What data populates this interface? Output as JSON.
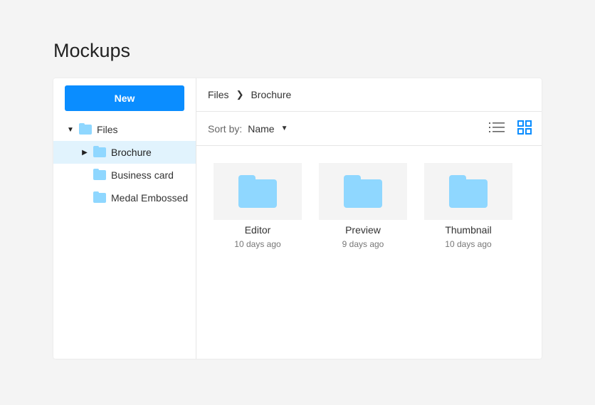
{
  "title": "Mockups",
  "sidebar": {
    "new_label": "New",
    "tree": [
      {
        "label": "Files",
        "expanded": true
      },
      {
        "label": "Brochure",
        "selected": true
      },
      {
        "label": "Business card"
      },
      {
        "label": "Medal Embossed"
      }
    ]
  },
  "breadcrumb": [
    "Files",
    "Brochure"
  ],
  "toolbar": {
    "sort_label": "Sort by:",
    "sort_value": "Name",
    "active_view": "grid"
  },
  "files": [
    {
      "name": "Editor",
      "modified": "10 days ago"
    },
    {
      "name": "Preview",
      "modified": "9 days ago"
    },
    {
      "name": "Thumbnail",
      "modified": "10 days ago"
    }
  ],
  "colors": {
    "accent": "#0a8dff",
    "folder": "#8fd7ff",
    "selected": "#e1f3fd"
  }
}
